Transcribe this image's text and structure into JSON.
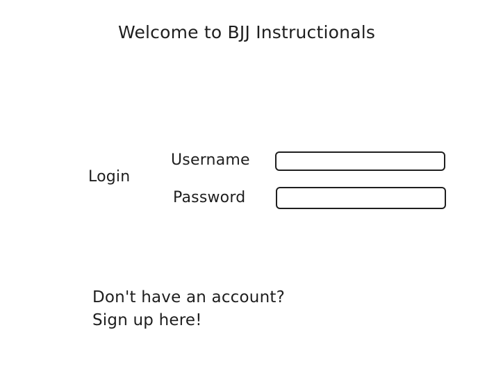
{
  "header": {
    "title": "Welcome to BJJ Instructionals"
  },
  "login_form": {
    "section_label": "Login",
    "username_label": "Username",
    "username_value": "",
    "password_label": "Password",
    "password_value": ""
  },
  "signup": {
    "question": "Don't have an account?",
    "link_text": "Sign up here!"
  }
}
